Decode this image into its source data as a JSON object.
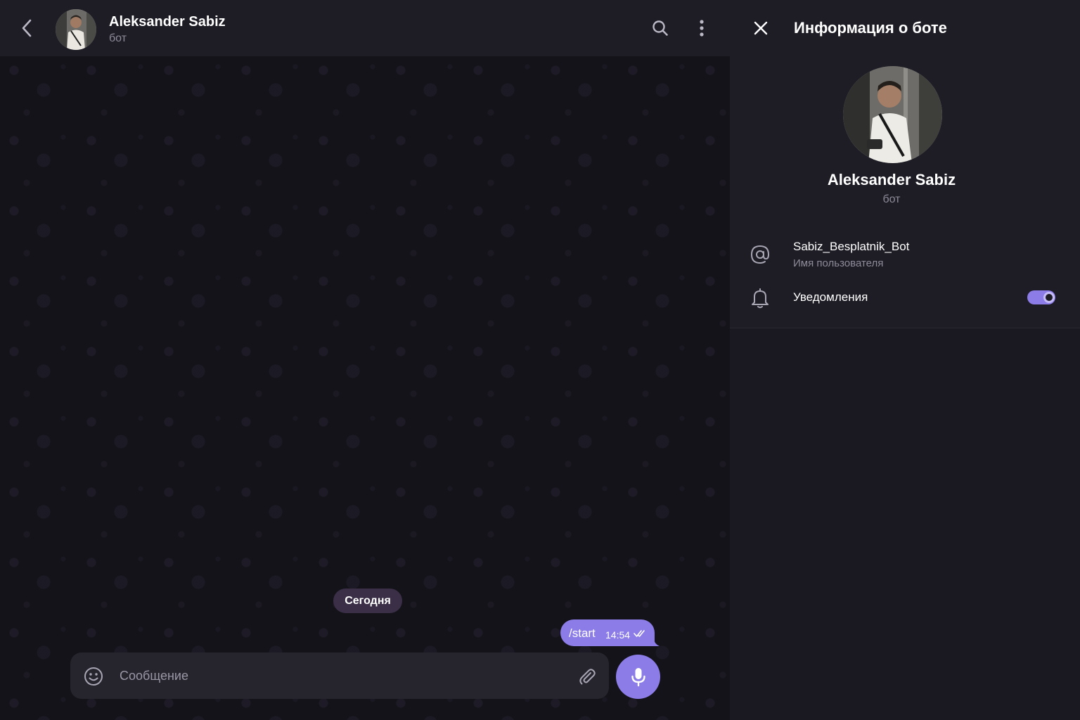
{
  "chat": {
    "header": {
      "title": "Aleksander Sabiz",
      "subtitle": "бот"
    },
    "date_divider": "Сегодня",
    "messages": [
      {
        "text": "/start",
        "time": "14:54",
        "status": "read",
        "outgoing": true
      }
    ],
    "composer": {
      "placeholder": "Сообщение",
      "value": ""
    }
  },
  "info_panel": {
    "title": "Информация о боте",
    "name": "Aleksander Sabiz",
    "subtitle": "бот",
    "username": {
      "value": "Sabiz_Besplatnik_Bot",
      "label": "Имя пользователя"
    },
    "notifications": {
      "label": "Уведомления",
      "enabled": true
    }
  },
  "colors": {
    "accent": "#8b7ce8",
    "background": "#141319",
    "header": "#1e1d25",
    "panel": "#1a1921",
    "secondary_text": "#8e8b99",
    "date_pill": "#3a2f47"
  },
  "icons": {
    "back": "chevron-left-icon",
    "search": "search-icon",
    "more": "more-vertical-icon",
    "emoji": "emoji-icon",
    "attach": "paperclip-icon",
    "mic": "microphone-icon",
    "close": "close-icon",
    "username": "at-sign-icon",
    "notifications": "bell-icon",
    "read_receipt": "double-check-icon"
  }
}
